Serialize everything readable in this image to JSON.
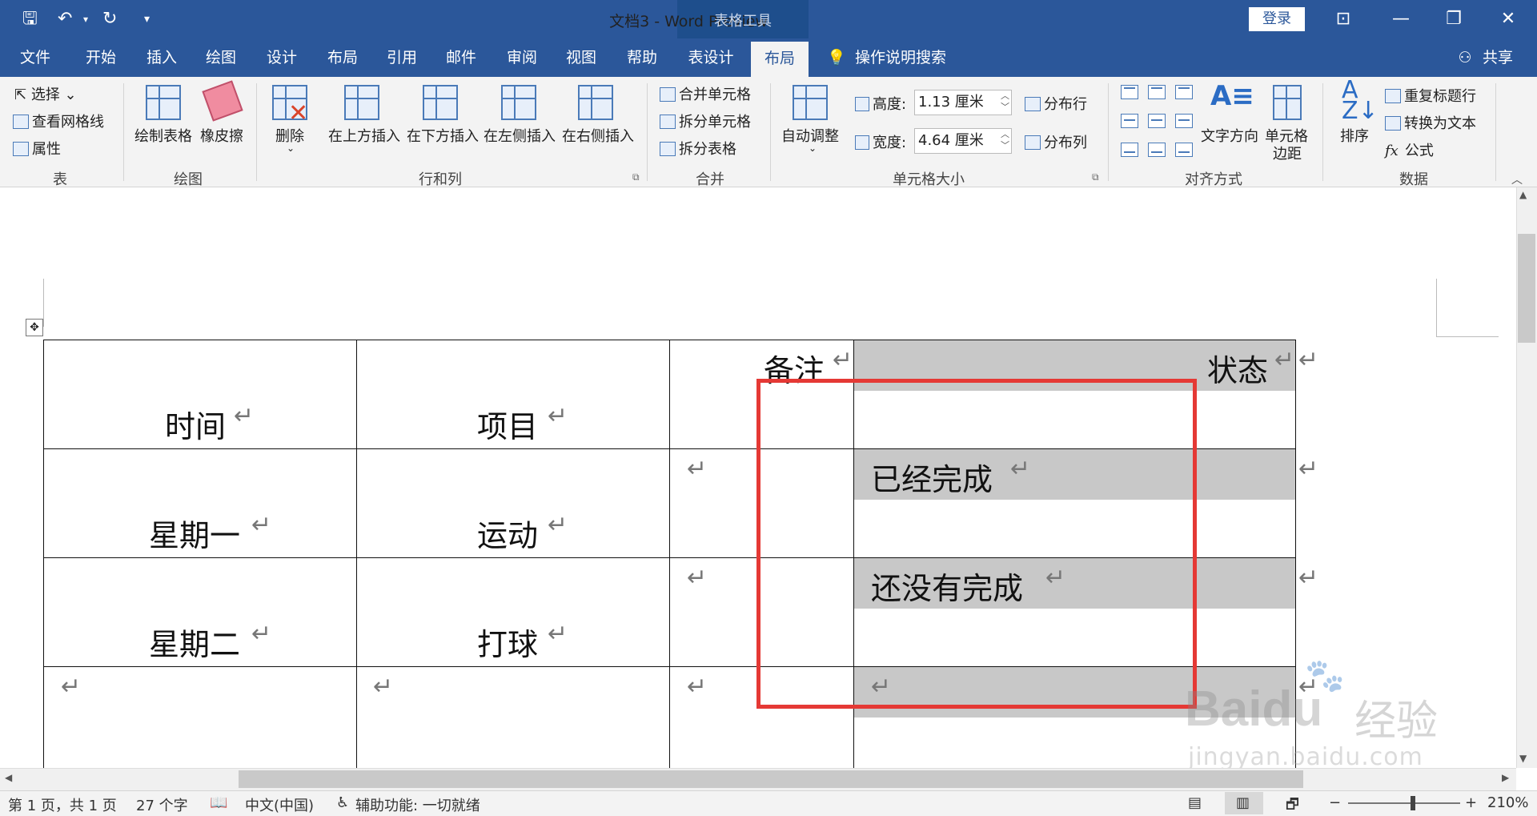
{
  "titlebar": {
    "doc_title": "文档3  -  Word Preview",
    "context_tools": "表格工具",
    "login": "登录",
    "share": "共享",
    "qa_dropdown": "▾"
  },
  "tabs": [
    "文件",
    "开始",
    "插入",
    "绘图",
    "设计",
    "布局",
    "引用",
    "邮件",
    "审阅",
    "视图",
    "帮助",
    "表设计",
    "布局"
  ],
  "active_tab": "布局",
  "tell_me": "操作说明搜索",
  "ribbon": {
    "table_group": {
      "select": "选择",
      "gridlines": "查看网格线",
      "properties": "属性",
      "label": "表"
    },
    "draw_group": {
      "draw_table": "绘制表格",
      "eraser": "橡皮擦",
      "label": "绘图"
    },
    "rows_cols": {
      "delete": "删除",
      "insert_above": "在上方插入",
      "insert_below": "在下方插入",
      "insert_left": "在左侧插入",
      "insert_right": "在右侧插入",
      "label": "行和列"
    },
    "merge": {
      "merge_cells": "合并单元格",
      "split_cells": "拆分单元格",
      "split_table": "拆分表格",
      "label": "合并"
    },
    "cell_size": {
      "autofit": "自动调整",
      "height_label": "高度:",
      "height_value": "1.13 厘米",
      "width_label": "宽度:",
      "width_value": "4.64 厘米",
      "dist_rows": "分布行",
      "dist_cols": "分布列",
      "label": "单元格大小"
    },
    "alignment": {
      "text_direction": "文字方向",
      "cell_margins_1": "单元格",
      "cell_margins_2": "边距",
      "label": "对齐方式"
    },
    "data": {
      "sort": "排序",
      "repeat_header": "重复标题行",
      "to_text": "转换为文本",
      "formula": "公式",
      "label": "数据"
    }
  },
  "table": {
    "header": {
      "col1": "时间",
      "col2": "项目",
      "col3": "备注",
      "col4": "状态"
    },
    "rows": [
      {
        "col1": "星期一",
        "col2": "运动",
        "col4": "已经完成"
      },
      {
        "col1": "星期二",
        "col2": "打球",
        "col4": "还没有完成"
      }
    ],
    "return_mark": "↵"
  },
  "statusbar": {
    "page": "第 1 页，共 1 页",
    "words": "27 个字",
    "lang": "中文(中国)",
    "accessibility": "辅助功能: 一切就绪",
    "zoom": "210%"
  },
  "watermark": {
    "brand": "Baidu",
    "cn": "经验",
    "url": "jingyan.baidu.com"
  }
}
